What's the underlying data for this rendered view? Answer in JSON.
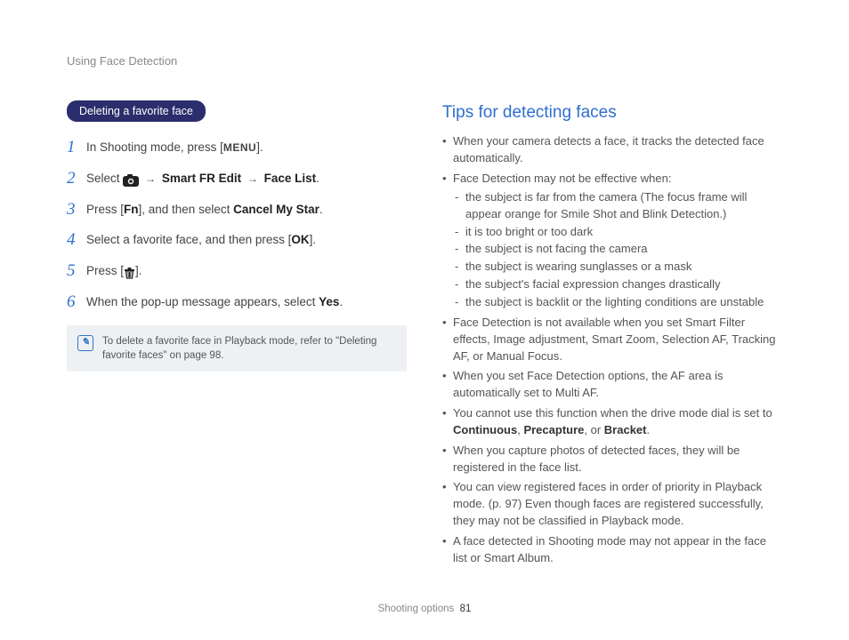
{
  "breadcrumb": "Using Face Detection",
  "left": {
    "section_title": "Deleting a favorite face",
    "steps": [
      {
        "num": "1",
        "pre": "In Shooting mode, press [",
        "label": "MENU",
        "post": "]."
      },
      {
        "num": "2",
        "pre": "Select ",
        "chain1": "Smart FR Edit",
        "chain2": "Face List",
        "post": "."
      },
      {
        "num": "3",
        "pre": "Press [",
        "label": "Fn",
        "mid": "], and then select ",
        "target": "Cancel My Star",
        "post": "."
      },
      {
        "num": "4",
        "pre": "Select a favorite face, and then press [",
        "label": "OK",
        "post": "]."
      },
      {
        "num": "5",
        "pre": "Press [",
        "post": "]."
      },
      {
        "num": "6",
        "pre": "When the pop-up message appears, select ",
        "target": "Yes",
        "post": "."
      }
    ],
    "note": "To delete a favorite face in Playback mode, refer to \"Deleting favorite faces\" on page 98."
  },
  "right": {
    "heading": "Tips for detecting faces",
    "items": [
      {
        "text": "When your camera detects a face, it tracks the detected face automatically."
      },
      {
        "text": "Face Detection may not be effective when:",
        "sub": [
          "the subject is far from the camera (The focus frame will appear orange for Smile Shot and Blink Detection.)",
          "it is too bright or too dark",
          "the subject is not facing the camera",
          "the subject is wearing sunglasses or a mask",
          "the subject's facial expression changes drastically",
          "the subject is backlit or the lighting conditions are unstable"
        ]
      },
      {
        "text": "Face Detection is not available when you set Smart Filter effects, Image adjustment, Smart Zoom, Selection AF, Tracking AF, or Manual Focus."
      },
      {
        "text": "When you set Face Detection options, the AF area is automatically set to Multi AF."
      },
      {
        "text_pre": "You cannot use this function when the drive mode dial is set to ",
        "bold1": "Continuous",
        "sep1": ", ",
        "bold2": "Precapture",
        "sep2": ", or ",
        "bold3": "Bracket",
        "post": "."
      },
      {
        "text": "When you capture photos of detected faces, they will be registered in the face list."
      },
      {
        "text": "You can view registered faces in order of priority in Playback mode. (p. 97) Even though faces are registered successfully, they may not be classified in Playback mode."
      },
      {
        "text": "A face detected in Shooting mode may not appear in the face list or Smart Album."
      }
    ]
  },
  "footer": {
    "section": "Shooting options",
    "page": "81"
  }
}
